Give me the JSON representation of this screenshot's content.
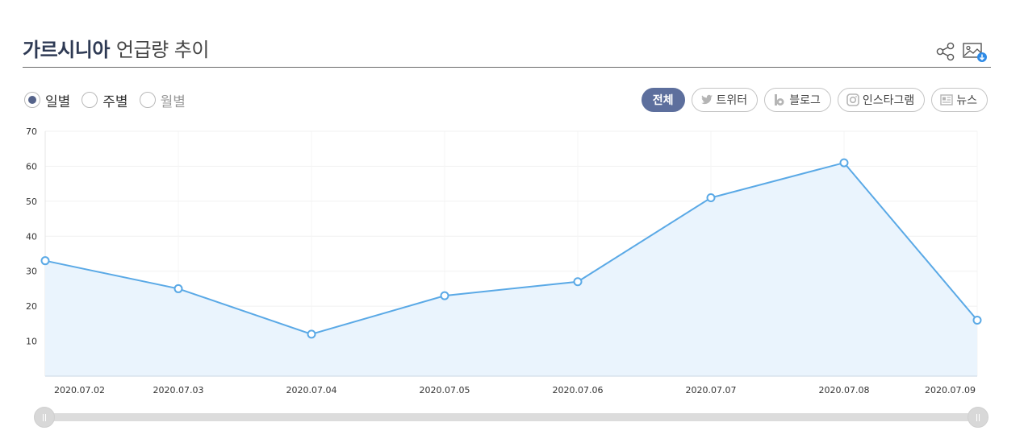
{
  "header": {
    "title_strong": "가르시니아",
    "title_rest": "언급량 추이"
  },
  "icons": {
    "share": "share-icon",
    "download": "image-download-icon"
  },
  "period_options": [
    {
      "label": "일별",
      "checked": true
    },
    {
      "label": "주별",
      "checked": false
    },
    {
      "label": "월별",
      "checked": false
    }
  ],
  "source_filters": [
    {
      "label": "전체",
      "active": true
    },
    {
      "label": "트위터",
      "icon": "twitter-icon"
    },
    {
      "label": "블로그",
      "icon": "blog-icon"
    },
    {
      "label": "인스타그램",
      "icon": "instagram-icon"
    },
    {
      "label": "뉴스",
      "icon": "news-icon"
    }
  ],
  "colors": {
    "line": "#5aa9e6",
    "area": "#eaf4fd",
    "accent": "#5d6f9d"
  },
  "chart_data": {
    "type": "area",
    "categories": [
      "2020.07.02",
      "2020.07.03",
      "2020.07.04",
      "2020.07.05",
      "2020.07.06",
      "2020.07.07",
      "2020.07.08",
      "2020.07.09"
    ],
    "values": [
      33,
      25,
      12,
      23,
      27,
      51,
      61,
      16
    ],
    "yticks": [
      10,
      20,
      30,
      40,
      50,
      60,
      70
    ],
    "ylim": [
      0,
      70
    ],
    "grid": true,
    "legend": "none"
  }
}
